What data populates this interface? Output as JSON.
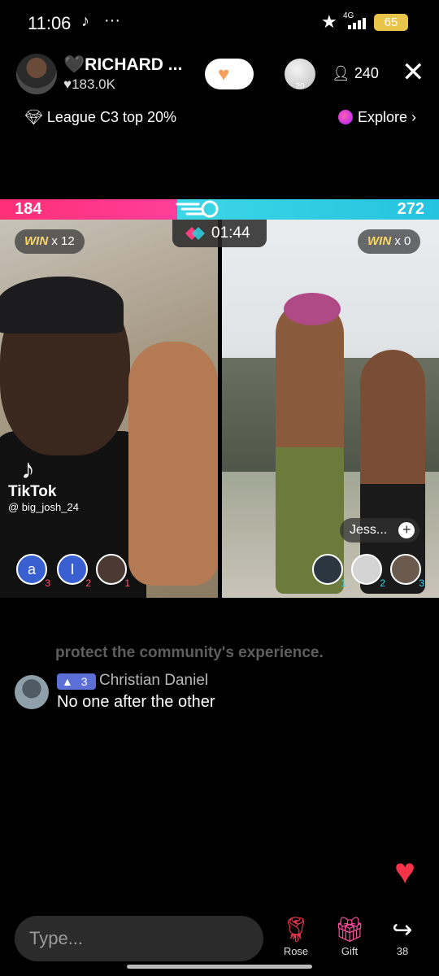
{
  "status_bar": {
    "time": "11:06",
    "network": "4G",
    "battery": "65"
  },
  "host": {
    "name": "🖤RICHARD ...",
    "likes": "♥183.0K"
  },
  "header": {
    "viewer_count": "240",
    "coin_value": "20"
  },
  "league": {
    "text": "League C3 top 20%"
  },
  "explore": {
    "label": "Explore"
  },
  "battle": {
    "left_score": "184",
    "right_score": "272",
    "left_share": 0.403,
    "timer": "01:44",
    "left_win": {
      "label": "WIN",
      "count": "x 12"
    },
    "right_win": {
      "label": "WIN",
      "count": "x 0"
    }
  },
  "watermark": {
    "name": "TikTok",
    "user": "@ big_josh_24"
  },
  "right_guest": {
    "name": "Jess..."
  },
  "left_supporters": [
    {
      "initial": "a",
      "rank": "3"
    },
    {
      "initial": "I",
      "rank": "2"
    },
    {
      "initial": "",
      "rank": "1"
    }
  ],
  "right_supporters": [
    {
      "rank": "1"
    },
    {
      "rank": "2"
    },
    {
      "rank": "3"
    }
  ],
  "comments": {
    "faded_text": "protect the community's experience.",
    "items": [
      {
        "level": "3",
        "user": "Christian Daniel",
        "text": "No one after the other"
      }
    ]
  },
  "input": {
    "placeholder": "Type..."
  },
  "bottom_actions": [
    {
      "icon": "rose-icon",
      "label": "Rose"
    },
    {
      "icon": "gift-icon",
      "label": "Gift"
    },
    {
      "icon": "share-icon",
      "label": "38"
    }
  ],
  "colors": {
    "left_team": "#ff2f75",
    "right_team": "#3ed6e6",
    "win": "#f6d56a",
    "like_heart": "#f53349"
  }
}
